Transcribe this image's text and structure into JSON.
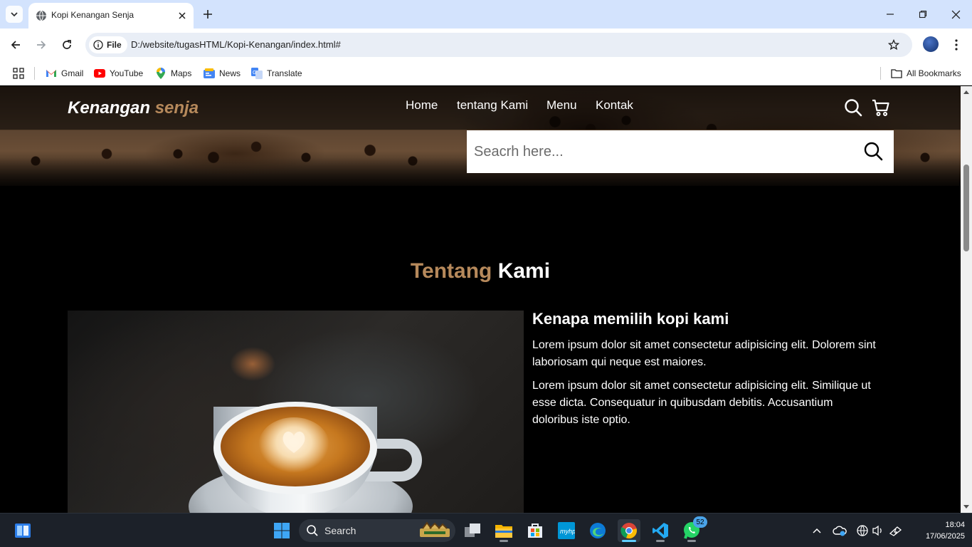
{
  "browser": {
    "tab": {
      "title": "Kopi Kenangan Senja"
    },
    "address": {
      "chip": "File",
      "url": "D:/website/tugasHTML/Kopi-Kenangan/index.html#"
    },
    "bookmarks": [
      {
        "label": "Gmail",
        "icon": "gmail-icon"
      },
      {
        "label": "YouTube",
        "icon": "youtube-icon"
      },
      {
        "label": "Maps",
        "icon": "maps-icon"
      },
      {
        "label": "News",
        "icon": "news-icon"
      },
      {
        "label": "Translate",
        "icon": "translate-icon"
      }
    ],
    "all_bookmarks": "All Bookmarks"
  },
  "site": {
    "logo": {
      "main": "Kenangan ",
      "accent": "senja"
    },
    "nav": [
      "Home",
      "tentang Kami",
      "Menu",
      "Kontak"
    ],
    "search": {
      "placeholder": "Seacrh here..."
    },
    "about": {
      "title_accent": "Tentang",
      "title_main": " Kami",
      "heading": "Kenapa memilih kopi kami",
      "paragraphs": [
        "Lorem ipsum dolor sit amet consectetur adipisicing elit. Dolorem sint laboriosam qui neque est maiores.",
        "Lorem ipsum dolor sit amet consectetur adipisicing elit. Similique ut esse dicta. Consequatur in quibusdam debitis. Accusantium doloribus iste optio."
      ]
    },
    "colors": {
      "accent": "#b6895b",
      "background": "#000000"
    }
  },
  "taskbar": {
    "search_label": "Search",
    "whatsapp_badge": "52",
    "time": "18:04",
    "date": "17/06/2025"
  }
}
